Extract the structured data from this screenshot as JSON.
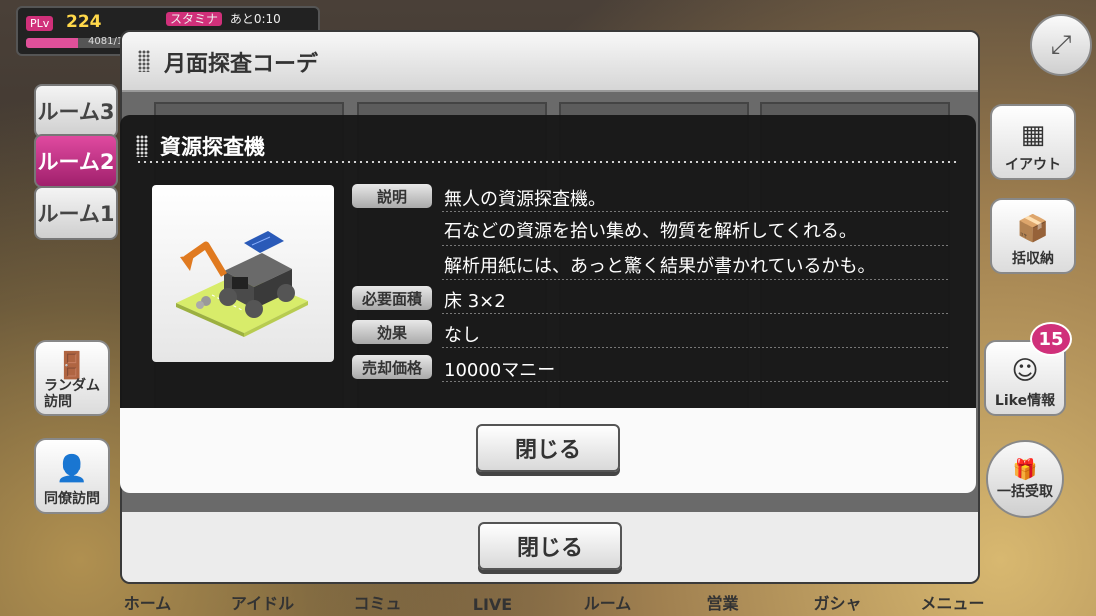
{
  "hud": {
    "plv_badge": "PLv",
    "level": "224",
    "exp_text": "4081/10",
    "exp_progress": 0.4,
    "stamina_badge": "スタミナ",
    "stamina_timer": "あと0:10"
  },
  "rooms": [
    "ルーム3",
    "ルーム2",
    "ルーム1"
  ],
  "active_room": "ルーム2",
  "side_left": {
    "random_visit": "ランダム\n訪問",
    "colleague_visit": "同僚訪問"
  },
  "side_right": {
    "layout": "イアウト",
    "bulk_store": "括収納",
    "like_info": "Like情報",
    "like_count": "15",
    "bulk_receive": "一括受取"
  },
  "bottom_nav": [
    "ホーム",
    "アイドル",
    "コミュ",
    "LIVE",
    "ルーム",
    "営業",
    "ガシャ",
    "メニュー"
  ],
  "outer_dialog": {
    "title": "月面探査コーデ",
    "close_label": "閉じる"
  },
  "inner_dialog": {
    "title": "資源探査機",
    "description_label": "説明",
    "description_lines": [
      "無人の資源探査機。",
      "石などの資源を拾い集め、物質を解析してくれる。",
      "解析用紙には、あっと驚く結果が書かれているかも。"
    ],
    "area_label": "必要面積",
    "area_value": "床 3×2",
    "effect_label": "効果",
    "effect_value": "なし",
    "sell_label": "売却価格",
    "sell_value": "10000マニー",
    "close_label": "閉じる"
  },
  "colors": {
    "accent_pink": "#d0307a",
    "dialog_dark": "#161616",
    "label_gray": "#a9a9a9"
  }
}
